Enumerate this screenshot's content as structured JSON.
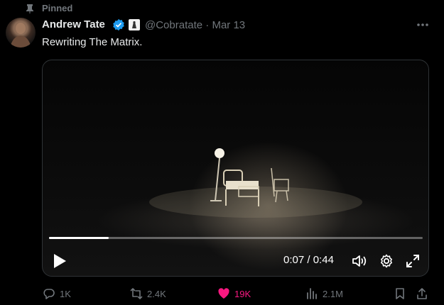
{
  "pinned": {
    "label": "Pinned",
    "icon": "pin-icon"
  },
  "author": {
    "name": "Andrew Tate",
    "verified_icon": "verified-badge-icon",
    "affiliate_icon": "affiliate-badge-icon",
    "handle": "@Cobratate",
    "separator": "·",
    "date": "Mar 13"
  },
  "tweet": {
    "text": "Rewriting The Matrix."
  },
  "video": {
    "current_time": "0:07",
    "duration": "0:44",
    "time_separator": " / ",
    "progress_fraction": 0.16
  },
  "actions": {
    "reply_count": "1K",
    "repost_count": "2.4K",
    "like_count": "19K",
    "views_count": "2.1M"
  },
  "colors": {
    "background": "#000000",
    "text_primary": "#e7e9ea",
    "text_secondary": "#71767b",
    "verified_blue": "#1d9bf0",
    "like_pink": "#f91880"
  }
}
